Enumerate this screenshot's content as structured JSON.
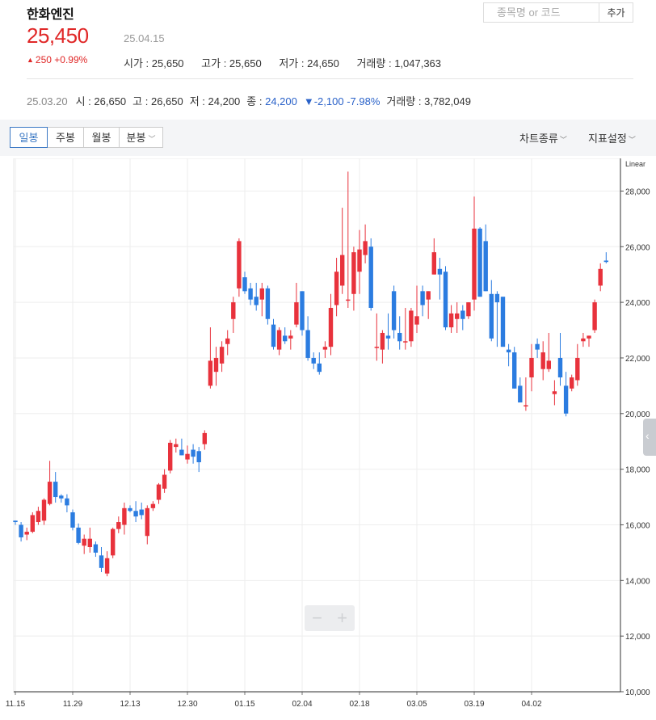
{
  "header": {
    "stock_name": "한화엔진",
    "price": "25,450",
    "date": "25.04.15",
    "change": "250 +0.99%",
    "stats": [
      {
        "label": "시가 : ",
        "value": "25,650"
      },
      {
        "label": "고가 : ",
        "value": "25,650"
      },
      {
        "label": "저가 : ",
        "value": "24,650"
      },
      {
        "label": "거래량 : ",
        "value": "1,047,363"
      }
    ]
  },
  "search": {
    "placeholder": "종목명 or 코드",
    "add_label": "추가"
  },
  "prev_day": {
    "date": "25.03.20",
    "open": "시 : 26,650",
    "high": "고 : 26,650",
    "low": "저 : 24,200",
    "close_label": "종 : ",
    "close_value": "24,200",
    "change": "▼-2,100 -7.98%",
    "volume": "거래량 : 3,782,049"
  },
  "toolbar": {
    "tabs": [
      "일봉",
      "주봉",
      "월봉",
      "분봉"
    ],
    "active_tab": "일봉",
    "chart_type": "차트종류",
    "indicator": "지표설정"
  },
  "colors": {
    "up": "#e8323c",
    "down": "#2b7ce0",
    "price_up": "#e02828",
    "accent": "#3b78c4"
  },
  "chart_data": {
    "type": "candlestick",
    "scale": "Linear",
    "ylim": [
      10000,
      29000
    ],
    "y_ticks": [
      10000,
      12000,
      14000,
      16000,
      18000,
      20000,
      22000,
      24000,
      26000,
      28000
    ],
    "y_tick_labels": [
      "10,000",
      "12,000",
      "14,000",
      "16,000",
      "18,000",
      "20,000",
      "22,000",
      "24,000",
      "26,000",
      "28,000"
    ],
    "x_tick_labels": [
      {
        "label": "11.15",
        "index": 0
      },
      {
        "label": "11.29",
        "index": 10
      },
      {
        "label": "12.13",
        "index": 20
      },
      {
        "label": "12.30",
        "index": 30
      },
      {
        "label": "01.15",
        "index": 40
      },
      {
        "label": "02.04",
        "index": 50
      },
      {
        "label": "02.18",
        "index": 60
      },
      {
        "label": "03.05",
        "index": 70
      },
      {
        "label": "03.19",
        "index": 80
      },
      {
        "label": "04.02",
        "index": 90
      }
    ],
    "candles": [
      [
        16150,
        16150,
        16000,
        16100
      ],
      [
        16000,
        16100,
        15400,
        15550
      ],
      [
        15650,
        15900,
        15450,
        15750
      ],
      [
        15750,
        16450,
        15700,
        16350
      ],
      [
        16100,
        16650,
        16000,
        16500
      ],
      [
        16150,
        16950,
        16000,
        16900
      ],
      [
        16750,
        18300,
        16700,
        17550
      ],
      [
        17550,
        17900,
        16800,
        17000
      ],
      [
        17050,
        17100,
        16800,
        16950
      ],
      [
        16950,
        17100,
        16450,
        16700
      ],
      [
        16450,
        16550,
        15800,
        15900
      ],
      [
        15900,
        16050,
        15300,
        15350
      ],
      [
        15250,
        15650,
        14950,
        15500
      ],
      [
        15200,
        15900,
        15000,
        15500
      ],
      [
        15300,
        15400,
        14850,
        15000
      ],
      [
        14900,
        15200,
        14300,
        14450
      ],
      [
        14250,
        15050,
        14150,
        14800
      ],
      [
        14900,
        15900,
        14800,
        15850
      ],
      [
        15850,
        16300,
        15700,
        16100
      ],
      [
        16000,
        16800,
        15650,
        16600
      ],
      [
        16600,
        16700,
        16450,
        16500
      ],
      [
        16500,
        16850,
        16100,
        16300
      ],
      [
        16550,
        16800,
        16200,
        16350
      ],
      [
        15600,
        16700,
        15300,
        16600
      ],
      [
        16600,
        16850,
        16500,
        16750
      ],
      [
        16900,
        17500,
        16750,
        17450
      ],
      [
        17300,
        18000,
        17150,
        17800
      ],
      [
        17950,
        19050,
        17850,
        18950
      ],
      [
        18800,
        19100,
        18600,
        18900
      ],
      [
        18700,
        19100,
        18500,
        18500
      ],
      [
        18350,
        18850,
        18200,
        18550
      ],
      [
        18700,
        18900,
        18200,
        18450
      ],
      [
        18650,
        18800,
        17900,
        18250
      ],
      [
        18900,
        19400,
        18700,
        19300
      ],
      [
        21000,
        23100,
        20900,
        21900
      ],
      [
        21500,
        22400,
        21000,
        22000
      ],
      [
        21800,
        22600,
        21500,
        22400
      ],
      [
        22500,
        23000,
        22100,
        22700
      ],
      [
        23400,
        24200,
        22900,
        24000
      ],
      [
        24500,
        26300,
        24200,
        26200
      ],
      [
        24900,
        25100,
        24300,
        24400
      ],
      [
        24500,
        24700,
        23900,
        24100
      ],
      [
        24200,
        24700,
        23700,
        23900
      ],
      [
        24100,
        24700,
        23500,
        24500
      ],
      [
        24500,
        24600,
        23200,
        23400
      ],
      [
        23200,
        23400,
        22300,
        22400
      ],
      [
        22300,
        23100,
        22100,
        23000
      ],
      [
        22800,
        23100,
        22500,
        22600
      ],
      [
        22700,
        23000,
        22300,
        22800
      ],
      [
        23200,
        24700,
        23100,
        24000
      ],
      [
        24400,
        24400,
        22800,
        23000
      ],
      [
        23000,
        23500,
        21900,
        22000
      ],
      [
        22000,
        22200,
        21600,
        21800
      ],
      [
        21800,
        22200,
        21400,
        21500
      ],
      [
        22300,
        22600,
        22000,
        22400
      ],
      [
        22400,
        24300,
        22100,
        23800
      ],
      [
        23900,
        25600,
        23500,
        25100
      ],
      [
        24600,
        27400,
        24300,
        25700
      ],
      [
        24100,
        28700,
        23800,
        24100
      ],
      [
        24300,
        26000,
        23700,
        25800
      ],
      [
        25100,
        26600,
        24300,
        25900
      ],
      [
        25700,
        26800,
        25400,
        26200
      ],
      [
        26000,
        26300,
        23700,
        23800
      ],
      [
        22400,
        23600,
        21900,
        22400
      ],
      [
        22300,
        23000,
        21800,
        22900
      ],
      [
        22800,
        23600,
        22300,
        22700
      ],
      [
        24400,
        24600,
        22700,
        23000
      ],
      [
        22900,
        23500,
        22300,
        22600
      ],
      [
        22600,
        23800,
        22300,
        22600
      ],
      [
        22600,
        23800,
        22400,
        23700
      ],
      [
        23200,
        24600,
        22900,
        23500
      ],
      [
        24400,
        24600,
        23500,
        23900
      ],
      [
        24100,
        24400,
        23400,
        24400
      ],
      [
        25000,
        26300,
        25000,
        25800
      ],
      [
        25200,
        25600,
        24100,
        25000
      ],
      [
        25100,
        25300,
        23000,
        23100
      ],
      [
        23100,
        23900,
        22900,
        23600
      ],
      [
        23400,
        24000,
        22900,
        23600
      ],
      [
        23700,
        23900,
        23000,
        23400
      ],
      [
        23500,
        24000,
        23400,
        24000
      ],
      [
        24100,
        27800,
        23700,
        26650
      ],
      [
        26650,
        26700,
        24200,
        24200
      ],
      [
        26200,
        26800,
        24400,
        24400
      ],
      [
        24300,
        24800,
        22600,
        22700
      ],
      [
        24300,
        24400,
        22400,
        24000
      ],
      [
        24200,
        24200,
        22400,
        22400
      ],
      [
        22300,
        22500,
        21700,
        22200
      ],
      [
        22200,
        22400,
        20900,
        20900
      ],
      [
        21000,
        21300,
        20400,
        20400
      ],
      [
        20300,
        21300,
        20100,
        20300
      ],
      [
        21300,
        22500,
        20800,
        22000
      ],
      [
        22500,
        22700,
        22000,
        22300
      ],
      [
        21600,
        22600,
        21200,
        22200
      ],
      [
        21600,
        22900,
        21500,
        21900
      ],
      [
        20700,
        21200,
        20300,
        20800
      ],
      [
        22000,
        22900,
        21000,
        21300
      ],
      [
        21000,
        21500,
        19900,
        20000
      ],
      [
        20900,
        21400,
        20800,
        21300
      ],
      [
        21200,
        22500,
        21000,
        22000
      ],
      [
        22600,
        22900,
        22400,
        22700
      ],
      [
        22700,
        22800,
        22400,
        22800
      ],
      [
        23000,
        24100,
        22900,
        24000
      ],
      [
        24600,
        25400,
        24400,
        25200
      ],
      [
        25500,
        25800,
        25400,
        25450
      ]
    ]
  }
}
